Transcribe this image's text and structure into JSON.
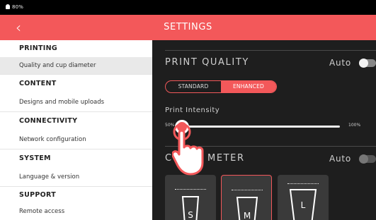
{
  "status_bar": {
    "battery": "80%"
  },
  "header": {
    "back_icon": "‹",
    "title": "SETTINGS"
  },
  "sidebar": {
    "sections": [
      {
        "heading": "PRINTING",
        "item": "Quality and cup diameter",
        "active": true
      },
      {
        "heading": "CONTENT",
        "item": "Designs and mobile uploads"
      },
      {
        "heading": "CONNECTIVITY",
        "item": "Network configuration"
      },
      {
        "heading": "SYSTEM",
        "item": "Language & version"
      },
      {
        "heading": "SUPPORT",
        "item": "Remote access"
      }
    ]
  },
  "print_quality": {
    "label": "PRINT QUALITY",
    "auto_label": "Auto",
    "auto_on": false,
    "options": [
      "STANDARD",
      "ENHANCED"
    ],
    "selected": "ENHANCED"
  },
  "print_intensity": {
    "label": "Print Intensity",
    "min_label": "50%",
    "max_label": "100%",
    "value_fraction": 0.0
  },
  "cup_diameter": {
    "label_left": "C",
    "label_right": "METER",
    "auto_label": "Auto",
    "auto_on": false,
    "sizes": [
      "S",
      "M",
      "L"
    ],
    "selected": "M"
  },
  "overlay": {
    "icon": "tap-hand-icon"
  },
  "colors": {
    "accent": "#f3585a",
    "sidebar_bg": "#ffffff",
    "content_bg": "#1e1e1e"
  }
}
